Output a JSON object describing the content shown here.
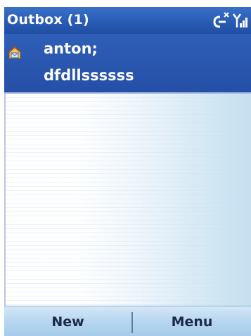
{
  "titlebar": {
    "title": "Outbox (1)",
    "icons": [
      "no-signal-icon",
      "signal-strength-icon"
    ]
  },
  "message": {
    "icon": "message-icon",
    "recipient": "anton;",
    "subject": "dfdllssssss"
  },
  "softkeys": {
    "left_label": "New",
    "right_label": "Menu"
  },
  "colors": {
    "titlebar": "#2a5cb4",
    "selected_row": "#2f5fb8",
    "softkey_bar": "#b7d6f0"
  }
}
